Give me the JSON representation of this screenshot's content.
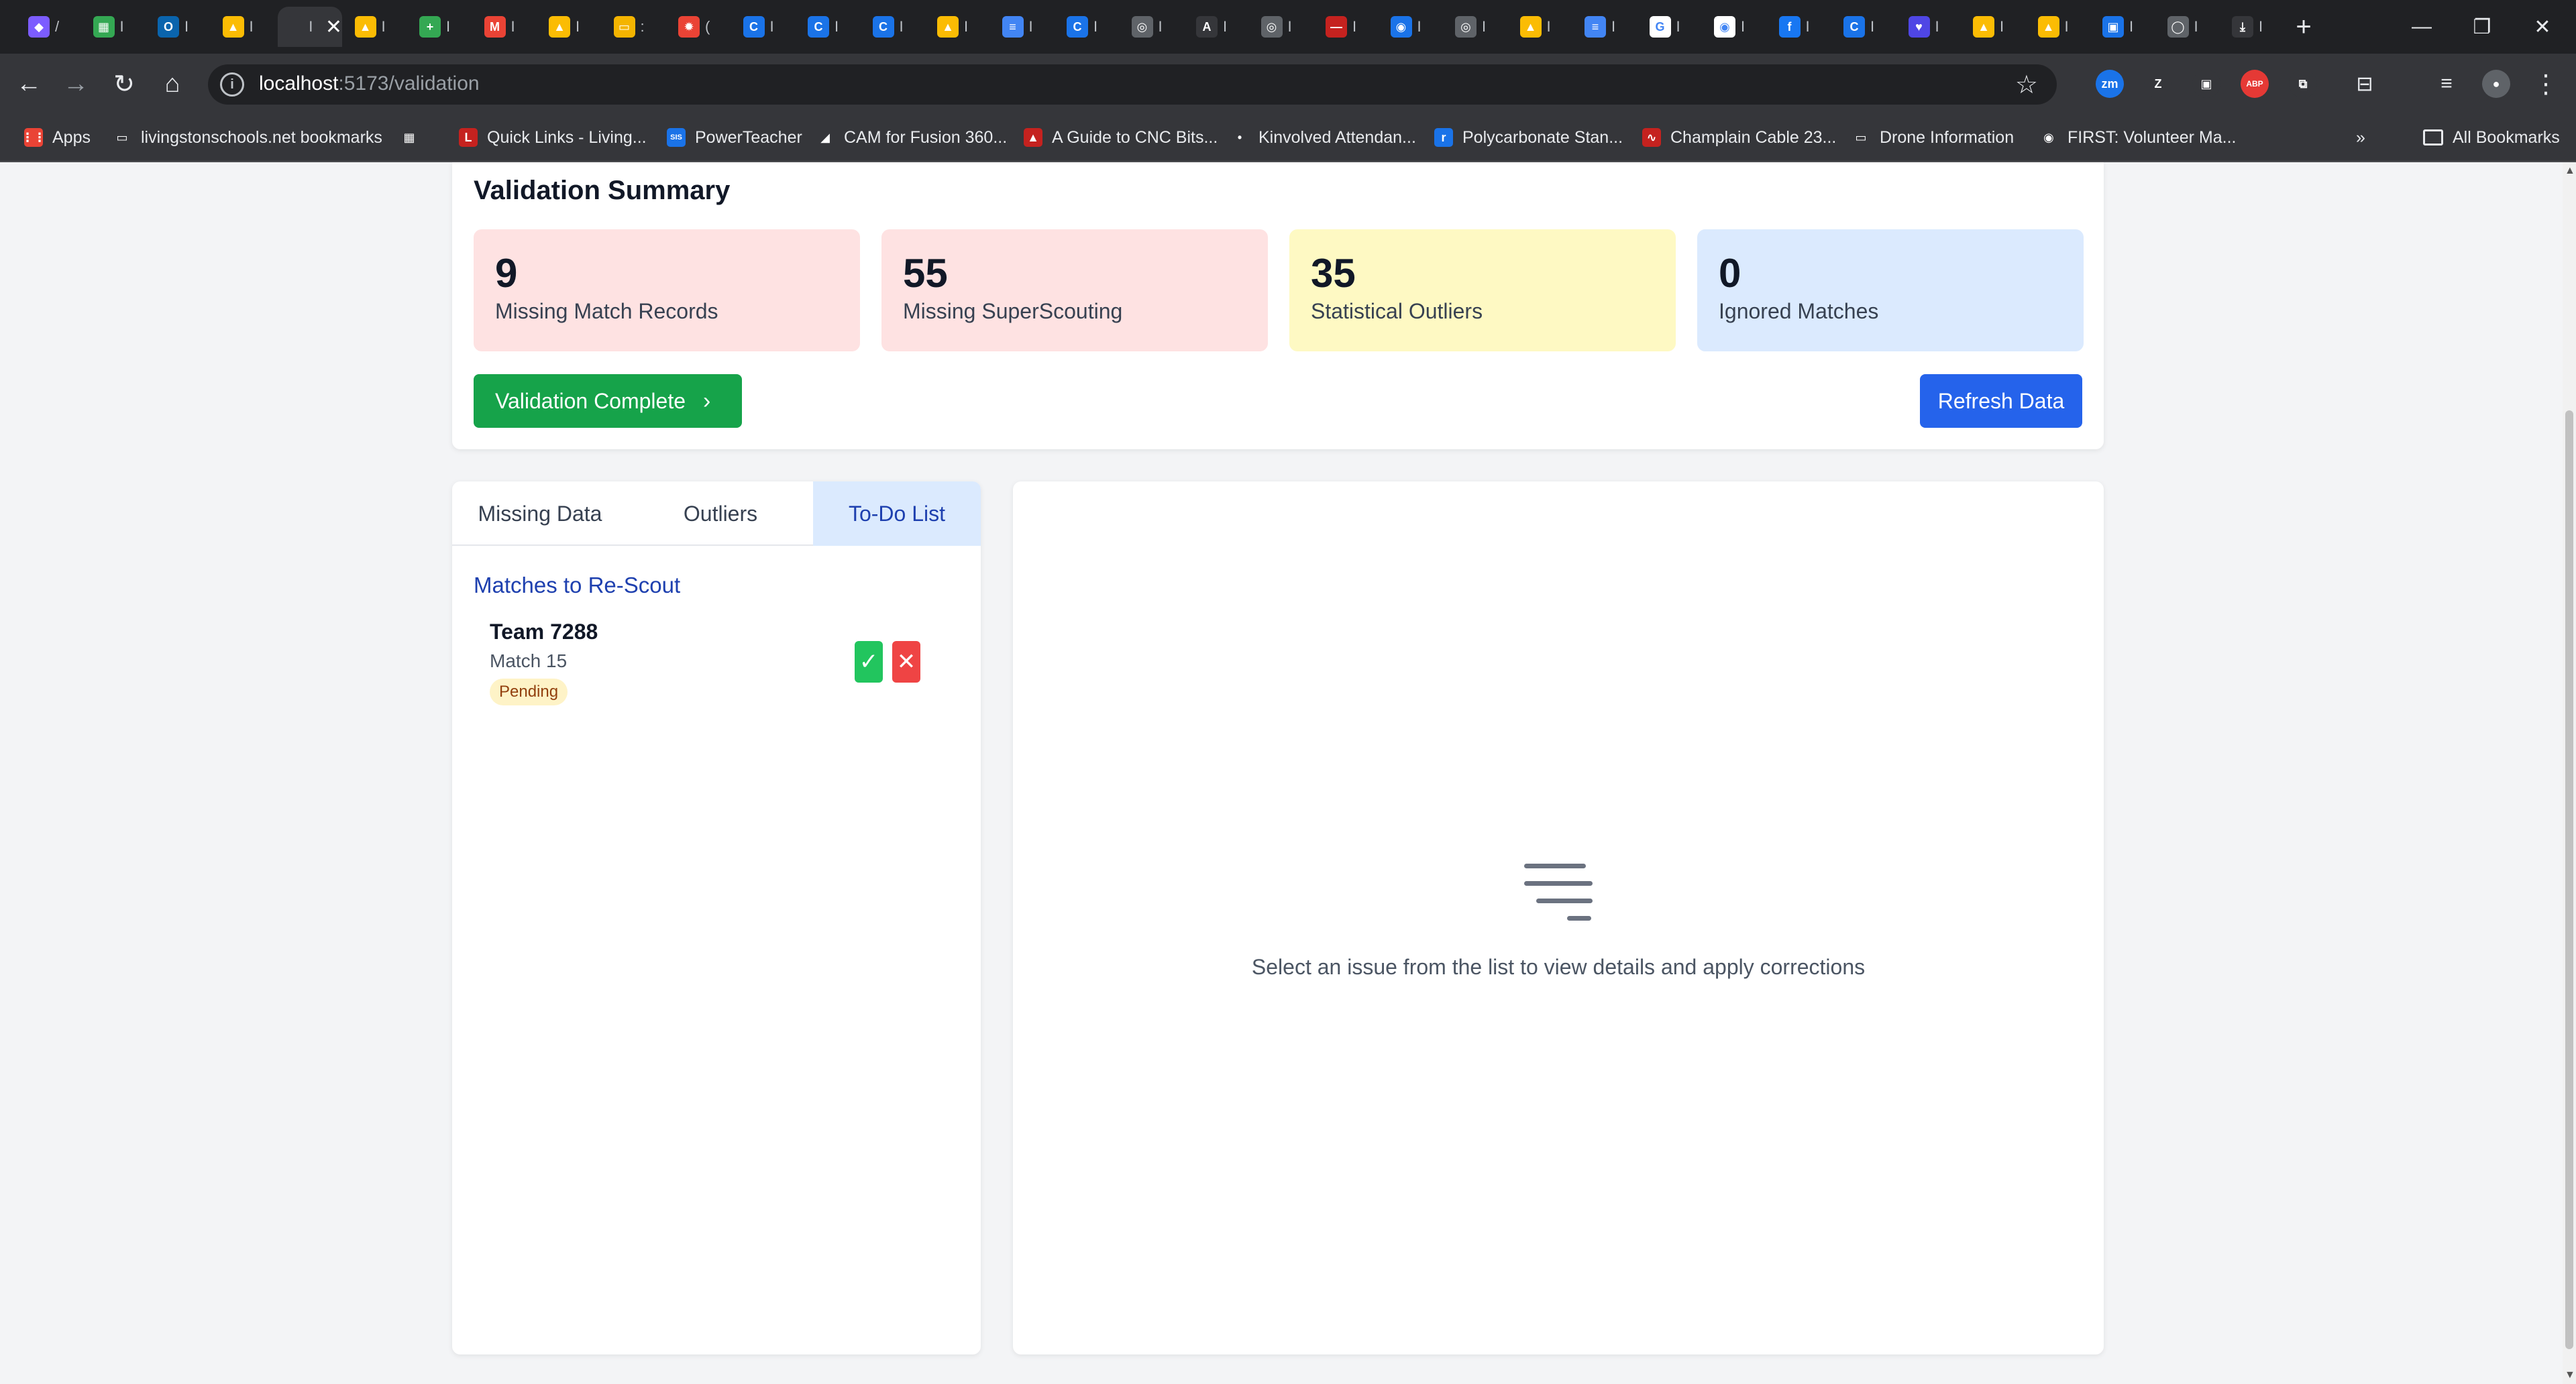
{
  "browser": {
    "tabs": [
      {
        "icon": "copilot-icon",
        "color": "#7c5cff",
        "glyph": "◆",
        "title": "/"
      },
      {
        "icon": "sheets-icon",
        "color": "#34a853",
        "glyph": "▦",
        "title": "I"
      },
      {
        "icon": "outlook-icon",
        "color": "#0a64ad",
        "glyph": "O",
        "title": "I"
      },
      {
        "icon": "drive-icon",
        "color": "#fbbc04",
        "glyph": "▲",
        "title": "I"
      },
      {
        "icon": "page-icon",
        "color": "#35363a",
        "glyph": "",
        "title": "I"
      },
      {
        "icon": "drive-icon",
        "color": "#fbbc04",
        "glyph": "▲",
        "title": "I"
      },
      {
        "icon": "sheets-icon",
        "color": "#34a853",
        "glyph": "+",
        "title": "I"
      },
      {
        "icon": "gmail-icon",
        "color": "#ea4335",
        "glyph": "M",
        "title": "I"
      },
      {
        "icon": "drive-icon",
        "color": "#fbbc04",
        "glyph": "▲",
        "title": "I"
      },
      {
        "icon": "slides-icon",
        "color": "#f4b400",
        "glyph": "▭",
        "title": ":"
      },
      {
        "icon": "spark-icon",
        "color": "#ea4335",
        "glyph": "✹",
        "title": "("
      },
      {
        "icon": "copilot-icon",
        "color": "#1a73e8",
        "glyph": "C",
        "title": "I"
      },
      {
        "icon": "copilot-icon",
        "color": "#1a73e8",
        "glyph": "C",
        "title": "I"
      },
      {
        "icon": "copilot-icon",
        "color": "#1a73e8",
        "glyph": "C",
        "title": "I"
      },
      {
        "icon": "drive-icon",
        "color": "#fbbc04",
        "glyph": "▲",
        "title": "I"
      },
      {
        "icon": "docs-icon",
        "color": "#4285f4",
        "glyph": "≡",
        "title": "I"
      },
      {
        "icon": "copilot-icon",
        "color": "#1a73e8",
        "glyph": "C",
        "title": "I"
      },
      {
        "icon": "globe-icon",
        "color": "#5f6368",
        "glyph": "◎",
        "title": "I"
      },
      {
        "icon": "text-icon",
        "color": "#35363a",
        "glyph": "A",
        "title": "I"
      },
      {
        "icon": "globe-icon",
        "color": "#5f6368",
        "glyph": "◎",
        "title": "I"
      },
      {
        "icon": "pill-icon",
        "color": "#c5221f",
        "glyph": "—",
        "title": "I"
      },
      {
        "icon": "robot-icon",
        "color": "#1a73e8",
        "glyph": "◉",
        "title": "I"
      },
      {
        "icon": "target-icon",
        "color": "#5f6368",
        "glyph": "◎",
        "title": "I"
      },
      {
        "icon": "drive-icon",
        "color": "#fbbc04",
        "glyph": "▲",
        "title": "I"
      },
      {
        "icon": "docs-icon",
        "color": "#4285f4",
        "glyph": "≡",
        "title": "I"
      },
      {
        "icon": "google-icon",
        "color": "#ffffff",
        "glyph": "G",
        "title": "I"
      },
      {
        "icon": "chrome-icon",
        "color": "#ffffff",
        "glyph": "◉",
        "title": "I"
      },
      {
        "icon": "facebook-icon",
        "color": "#1877f2",
        "glyph": "f",
        "title": "I"
      },
      {
        "icon": "copilot-icon",
        "color": "#1a73e8",
        "glyph": "C",
        "title": "I"
      },
      {
        "icon": "heart-icon",
        "color": "#4f46e5",
        "glyph": "♥",
        "title": "I"
      },
      {
        "icon": "drive-icon",
        "color": "#fbbc04",
        "glyph": "▲",
        "title": "I"
      },
      {
        "icon": "drive-icon",
        "color": "#fbbc04",
        "glyph": "▲",
        "title": "I"
      },
      {
        "icon": "app-icon",
        "color": "#1a73e8",
        "glyph": "▣",
        "title": "I"
      },
      {
        "icon": "github-icon",
        "color": "#5f6368",
        "glyph": "◯",
        "title": "I"
      },
      {
        "icon": "download-icon",
        "color": "#35363a",
        "glyph": "⤓",
        "title": "I"
      }
    ],
    "url_host": "localhost",
    "url_rest": ":5173/validation",
    "bookmarks": [
      {
        "label": "Apps",
        "icon": "apps-grid-icon",
        "color": "#ea4335",
        "glyph": "⋮⋮"
      },
      {
        "label": "livingstonschools.net bookmarks",
        "icon": "folder-icon",
        "color": "#35363a",
        "glyph": "▭"
      },
      {
        "label": "",
        "icon": "grid-icon",
        "color": "#35363a",
        "glyph": "▦"
      },
      {
        "label": "Quick Links - Living...",
        "icon": "quicklinks-icon",
        "color": "#c5221f",
        "glyph": "L"
      },
      {
        "label": "PowerTeacher",
        "icon": "powerschool-icon",
        "color": "#1a73e8",
        "glyph": "SIS"
      },
      {
        "label": "CAM for Fusion 360...",
        "icon": "cam-icon",
        "color": "#35363a",
        "glyph": "◢"
      },
      {
        "label": "A Guide to CNC Bits...",
        "icon": "cnc-icon",
        "color": "#c5221f",
        "glyph": "▲"
      },
      {
        "label": "Kinvolved Attendan...",
        "icon": "kinvolved-icon",
        "color": "#35363a",
        "glyph": "•"
      },
      {
        "label": "Polycarbonate Stan...",
        "icon": "poly-icon",
        "color": "#1a73e8",
        "glyph": "r"
      },
      {
        "label": "Champlain Cable 23...",
        "icon": "cable-icon",
        "color": "#c5221f",
        "glyph": "∿"
      },
      {
        "label": "Drone Information",
        "icon": "folder-icon",
        "color": "#35363a",
        "glyph": "▭"
      },
      {
        "label": "FIRST: Volunteer Ma...",
        "icon": "first-icon",
        "color": "#35363a",
        "glyph": "◉"
      }
    ],
    "more_glyph": "»",
    "all_bookmarks": "All Bookmarks",
    "extensions": [
      {
        "icon": "zm-icon",
        "color": "#1a73e8",
        "glyph": "zm"
      },
      {
        "icon": "zotero-icon",
        "color": "#35363a",
        "glyph": "Z"
      },
      {
        "icon": "screen-icon",
        "color": "#35363a",
        "glyph": "▣"
      },
      {
        "icon": "adblock-icon",
        "color": "#e53935",
        "glyph": "ABP"
      },
      {
        "icon": "puzzle-icon",
        "color": "#35363a",
        "glyph": "⧉"
      }
    ]
  },
  "summary": {
    "title": "Validation Summary",
    "stats": [
      {
        "value": "9",
        "label": "Missing Match Records",
        "bg": "#fee2e2"
      },
      {
        "value": "55",
        "label": "Missing SuperScouting",
        "bg": "#fee2e2"
      },
      {
        "value": "35",
        "label": "Statistical Outliers",
        "bg": "#fef9c3"
      },
      {
        "value": "0",
        "label": "Ignored Matches",
        "bg": "#dbeafe"
      }
    ],
    "complete_label": "Validation Complete",
    "refresh_label": "Refresh Data"
  },
  "left_panel": {
    "tabs": [
      "Missing Data",
      "Outliers",
      "To-Do List"
    ],
    "active_tab": "To-Do List",
    "section_title": "Matches to Re-Scout",
    "todo": {
      "team": "Team 7288",
      "match": "Match 15",
      "status": "Pending",
      "approve_glyph": "✓",
      "reject_glyph": "✕"
    }
  },
  "right_panel": {
    "empty_message": "Select an issue from the list to view details and apply corrections"
  }
}
